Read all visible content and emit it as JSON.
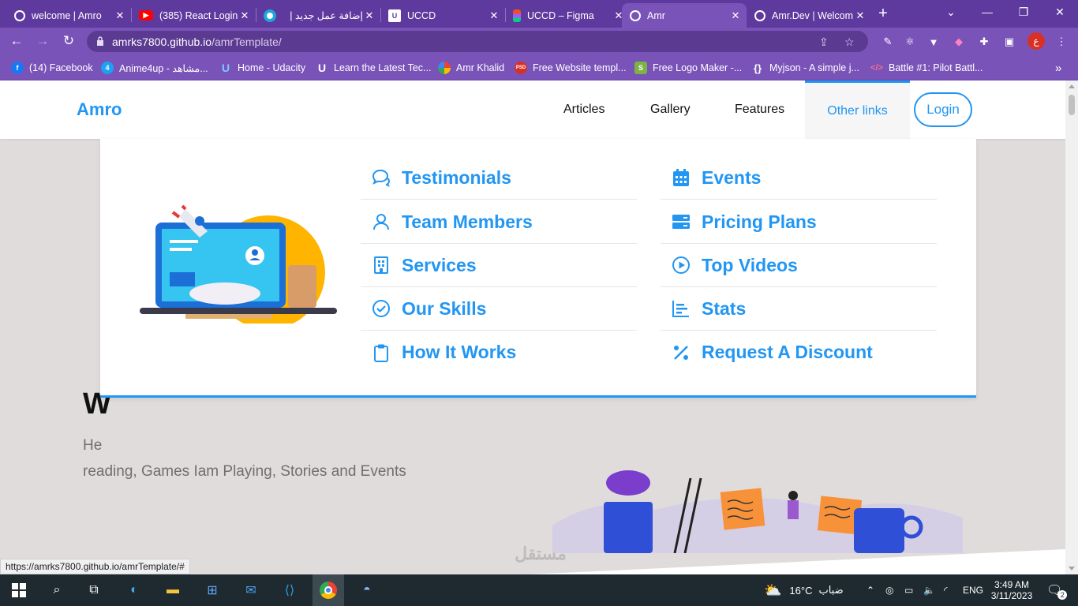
{
  "browser": {
    "tabs": [
      {
        "title": "welcome | Amro",
        "icon": "globe-icon"
      },
      {
        "title": "(385) React Login",
        "icon": "youtube-icon"
      },
      {
        "title": "إضافة عمل جديد |",
        "icon": "mostaql-icon"
      },
      {
        "title": "UCCD",
        "icon": "uccd-icon"
      },
      {
        "title": "UCCD – Figma",
        "icon": "figma-icon"
      },
      {
        "title": "Amr",
        "icon": "globe-icon"
      },
      {
        "title": "Amr.Dev | Welcom",
        "icon": "globe-icon"
      }
    ],
    "active_tab": 5,
    "url_host": "amrks7800.github.io",
    "url_path": "/amrTemplate/",
    "profile_initial": "ع",
    "bookmarks": [
      {
        "label": "(14) Facebook",
        "color": "#1877f2",
        "glyph": "f"
      },
      {
        "label": "Anime4up - مشاهد...",
        "color": "#1da1f2",
        "glyph": "4"
      },
      {
        "label": "Home - Udacity",
        "color": "#1a73e8",
        "glyph": "U"
      },
      {
        "label": "Learn the Latest Tec...",
        "color": "#5c2fd6",
        "glyph": "U"
      },
      {
        "label": "Amr Khalid",
        "color": "#e8453c",
        "glyph": "G"
      },
      {
        "label": "Free Website templ...",
        "color": "#d93025",
        "glyph": "PSD"
      },
      {
        "label": "Free Logo Maker -...",
        "color": "#7cb342",
        "glyph": "S"
      },
      {
        "label": "Myjson - A simple j...",
        "color": "#202124",
        "glyph": "{}"
      },
      {
        "label": "Battle #1: Pilot Battl...",
        "color": "#c2185b",
        "glyph": "<>"
      }
    ]
  },
  "site": {
    "logo": "Amro",
    "nav": {
      "articles": "Articles",
      "gallery": "Gallery",
      "features": "Features",
      "other": "Other links",
      "login": "Login"
    },
    "hero": {
      "title_partial": "W",
      "text_line1": "He",
      "text_line2": "reading, Games Iam Playing, Stories and Events"
    },
    "dropdown": {
      "left": [
        {
          "label": "Testimonials",
          "icon": "comments-icon"
        },
        {
          "label": "Team Members",
          "icon": "user-icon"
        },
        {
          "label": "Services",
          "icon": "building-icon"
        },
        {
          "label": "Our Skills",
          "icon": "check-circle-icon"
        },
        {
          "label": "How It Works",
          "icon": "clipboard-icon"
        }
      ],
      "right": [
        {
          "label": "Events",
          "icon": "calendar-icon"
        },
        {
          "label": "Pricing Plans",
          "icon": "server-icon"
        },
        {
          "label": "Top Videos",
          "icon": "play-circle-icon"
        },
        {
          "label": "Stats",
          "icon": "chart-bar-icon"
        },
        {
          "label": "Request A Discount",
          "icon": "percent-icon"
        }
      ]
    },
    "status_url": "https://amrks7800.github.io/amrTemplate/#",
    "watermark": "مستقل\nmostaql.com"
  },
  "taskbar": {
    "weather_temp": "16°C",
    "weather_desc": "ضباب",
    "lang": "ENG",
    "time": "3:49 AM",
    "date": "3/11/2023",
    "notifications": "2"
  },
  "colors": {
    "accent": "#2196f3",
    "browser": "#7a53b8"
  }
}
